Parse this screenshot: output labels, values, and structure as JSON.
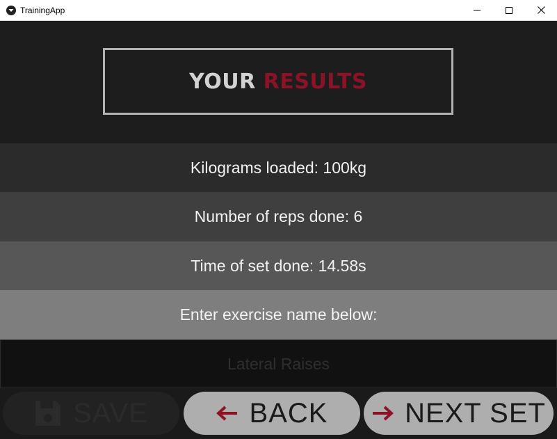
{
  "window": {
    "title": "TrainingApp"
  },
  "header": {
    "word1": "YOUR",
    "word2": "RESULTS",
    "accent_color": "#8c1226"
  },
  "results": {
    "kilograms": "Kilograms loaded: 100kg",
    "reps": "Number of reps done: 6",
    "time": "Time of set done: 14.58s",
    "prompt": "Enter exercise name below:"
  },
  "exercise_input": {
    "placeholder": "Lateral Raises",
    "value": ""
  },
  "buttons": {
    "save": {
      "label": "SAVE",
      "icon": "floppy-disk-icon",
      "enabled": false
    },
    "back": {
      "label": "BACK",
      "icon": "arrow-left-icon"
    },
    "next_set": {
      "label": "NEXT SET",
      "icon": "arrow-right-icon"
    }
  }
}
